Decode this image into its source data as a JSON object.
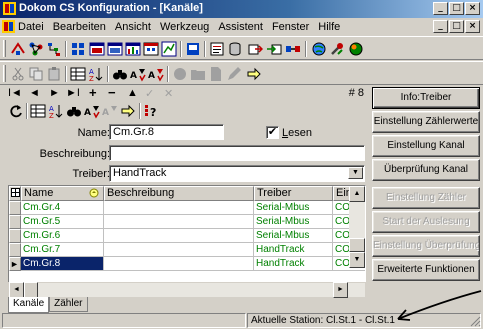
{
  "window": {
    "title": "Dokom CS Konfiguration - [Kanäle]",
    "minimize": "_",
    "maximize": "□",
    "close": "×"
  },
  "menu": {
    "items": [
      "Datei",
      "Bearbeiten",
      "Ansicht",
      "Werkzeug",
      "Assistent",
      "Fenster",
      "Hilfe"
    ]
  },
  "nav": {
    "first": "I◄",
    "prev": "◄",
    "next": "►",
    "last": "►I",
    "add": "+",
    "delete": "−",
    "edit": "▲",
    "post": "✓",
    "cancel": "✕",
    "record_counter": "# 8"
  },
  "form": {
    "name_label": "Name:",
    "name_value": "Cm.Gr.8",
    "lesen_label": "Lesen",
    "lesen_checked": "✔",
    "beschreibung_label": "Beschreibung:",
    "beschreibung_value": "",
    "treiber_label": "Treiber:",
    "treiber_value": "HandTrack"
  },
  "grid": {
    "columns": [
      "Name",
      "Beschreibung",
      "Treiber",
      "Ein"
    ],
    "rows": [
      {
        "name": "Cm.Gr.4",
        "beschreibung": "",
        "treiber": "Serial-Mbus",
        "ein": "COI"
      },
      {
        "name": "Cm.Gr.5",
        "beschreibung": "",
        "treiber": "Serial-Mbus",
        "ein": "COI"
      },
      {
        "name": "Cm.Gr.6",
        "beschreibung": "",
        "treiber": "Serial-Mbus",
        "ein": "COI"
      },
      {
        "name": "Cm.Gr.7",
        "beschreibung": "",
        "treiber": "HandTrack",
        "ein": "COI"
      },
      {
        "name": "Cm.Gr.8",
        "beschreibung": "",
        "treiber": "HandTrack",
        "ein": "COI"
      }
    ],
    "selected_row": 4
  },
  "tabs": [
    "Kanäle",
    "Zähler"
  ],
  "active_tab": "Kanäle",
  "buttons": {
    "info_treiber": "Info:Treiber",
    "einstellung_zaehlerwerte": "Einstellung Zählerwerte",
    "einstellung_kanal": "Einstellung Kanal",
    "ueberpruefung_kanal": "Überprüfung Kanal",
    "einstellung_zaehler": "Einstellung Zähler",
    "start_auslesung": "Start der Auslesung",
    "einstellung_ueberpruefung": "Einstellung Überprüfung",
    "erweiterte_funktionen": "Erweiterte Funktionen"
  },
  "status": {
    "station": "Aktuelle Station: Cl.St.1 - Cl.St.1"
  },
  "colors": {
    "title_start": "#0a246a",
    "title_end": "#a6caf0",
    "face": "#d4d0c8",
    "row_text": "#008000",
    "selection": "#0a246a"
  }
}
